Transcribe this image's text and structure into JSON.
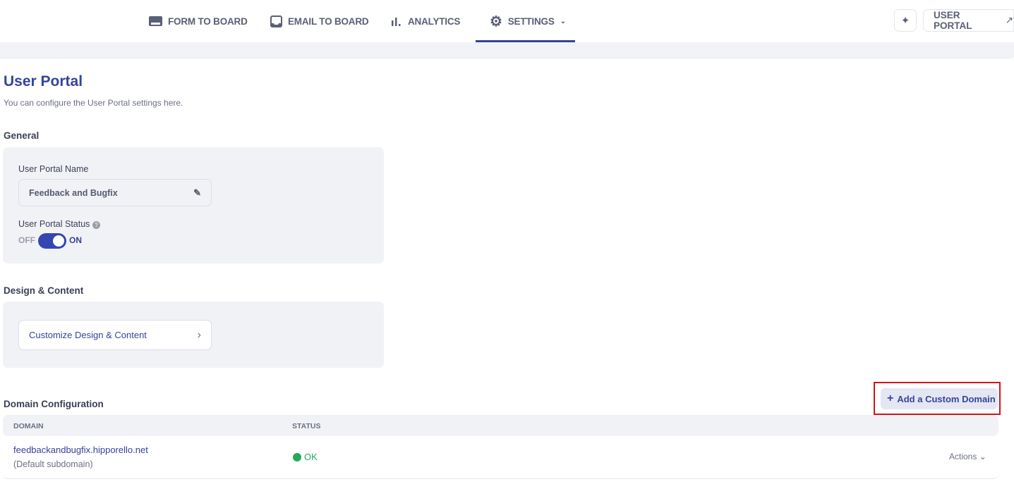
{
  "nav": {
    "items": [
      {
        "label": "FORM TO BOARD",
        "icon": "form-icon"
      },
      {
        "label": "EMAIL TO BOARD",
        "icon": "inbox-icon"
      },
      {
        "label": "ANALYTICS",
        "icon": "bar-chart-icon"
      },
      {
        "label": "SETTINGS",
        "icon": "gear-icon",
        "active": true
      }
    ],
    "user_portal": "USER PORTAL",
    "user_portal_arrow": "↗",
    "sparkle_icon": "sparkle-icon"
  },
  "page": {
    "title": "User Portal",
    "subtitle": "You can configure the User Portal settings here."
  },
  "general": {
    "heading": "General",
    "name_label": "User Portal Name",
    "name_value": "Feedback and Bugfix",
    "status_label": "User Portal Status",
    "off": "OFF",
    "on": "ON",
    "status_on": true
  },
  "design": {
    "heading": "Design & Content",
    "button": "Customize Design & Content",
    "chevron": "›"
  },
  "domain": {
    "heading": "Domain Configuration",
    "add_button": "Add a Custom Domain",
    "columns": [
      "DOMAIN",
      "STATUS"
    ],
    "rows": [
      {
        "domain": "feedbackandbugfix.hipporello.net",
        "note": "(Default subdomain)",
        "status": "OK",
        "status_color": "#27a85a",
        "actions": "Actions"
      }
    ]
  },
  "colors": {
    "accent": "#34449a",
    "highlight": "#d0161b"
  }
}
